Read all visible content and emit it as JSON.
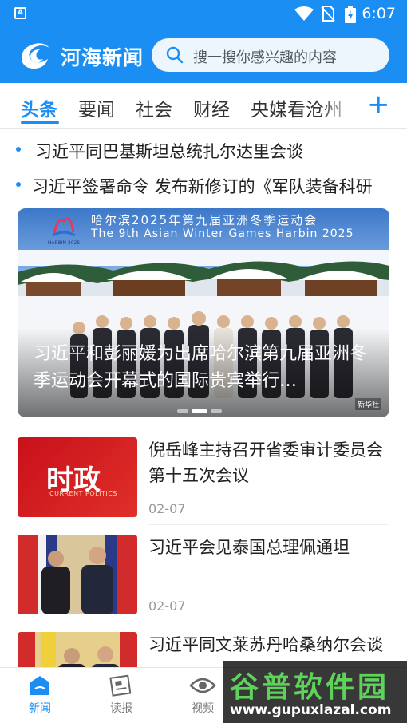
{
  "status_bar": {
    "time": "6:07",
    "app_icon_letter": "A"
  },
  "header": {
    "brand": "河海新闻",
    "search_placeholder": "搜一搜你感兴趣的内容",
    "bg_color": "#1a8ef2"
  },
  "tabs": [
    {
      "label": "头条",
      "active": true
    },
    {
      "label": "要闻",
      "active": false
    },
    {
      "label": "社会",
      "active": false
    },
    {
      "label": "财经",
      "active": false
    },
    {
      "label": "央媒看沧州",
      "active": false
    }
  ],
  "tab_add_icon": "+",
  "headlines": [
    "习近平同巴基斯坦总统扎尔达里会谈",
    "习近平签署命令  发布新修订的《军队装备科研"
  ],
  "banner": {
    "event_cn": "哈尔滨2025年第九届亚洲冬季运动会",
    "event_en": "The 9th Asian Winter Games Harbin 2025",
    "emblem_text": "HARBIN 2025",
    "caption": "习近平和彭丽媛为出席哈尔滨第九届亚洲冬季运动会开幕式的国际贵宾举行…",
    "slide_count": 3,
    "active_slide": 2,
    "watermark": "新华社"
  },
  "news": [
    {
      "title": "倪岳峰主持召开省委审计委员会第十五次会议",
      "date": "02-07",
      "thumb": {
        "cn": "时政",
        "en": "CURRENT POLITICS"
      }
    },
    {
      "title": "习近平会见泰国总理佩通坦",
      "date": "02-07"
    },
    {
      "title": "习近平同文莱苏丹哈桑纳尔会谈",
      "date": ""
    }
  ],
  "bottom_nav": [
    {
      "label": "新闻",
      "icon": "news-home-icon",
      "active": true
    },
    {
      "label": "读报",
      "icon": "newspaper-icon",
      "active": false
    },
    {
      "label": "视频",
      "icon": "eye-icon",
      "active": false
    }
  ],
  "site_watermark": {
    "cn": "谷普软件园",
    "url": "www.gupuxlazal.com"
  }
}
